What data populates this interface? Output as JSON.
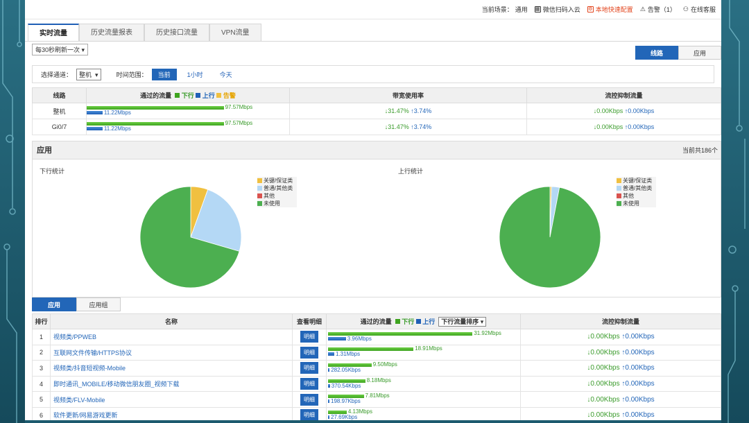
{
  "topbar": {
    "scene_label": "当前场景：",
    "scene_value": "通用",
    "wechat": "微信扫码入云",
    "quick_config": "本地快速配置",
    "alarm": "告警（1）",
    "support": "在线客服"
  },
  "tabs": [
    "实时流量",
    "历史流量报表",
    "历史接口流量",
    "VPN流量"
  ],
  "refresh_select": "每30秒刷新一次",
  "view_toggle": [
    "线路",
    "应用"
  ],
  "filter": {
    "channel_label": "选择通道：",
    "channel_value": "整机",
    "range_label": "时间范围：",
    "ranges": [
      "当前",
      "1小时",
      "今天"
    ]
  },
  "line_table": {
    "headers": {
      "line": "线路",
      "flow": "通过的流量",
      "down": "下行",
      "up": "上行",
      "alarm": "告警",
      "bw": "带宽使用率",
      "ctrl": "流控抑制流量"
    },
    "rows": [
      {
        "name": "整机",
        "down": "97.57Mbps",
        "up": "11.22Mbps",
        "down_pct": 0.95,
        "up_pct": 0.11,
        "bw_down": "↓31.47%",
        "bw_up": "↑3.74%",
        "ctrl_down": "↓0.00Kbps",
        "ctrl_up": "↑0.00Kbps"
      },
      {
        "name": "Gi0/7",
        "down": "97.57Mbps",
        "up": "11.22Mbps",
        "down_pct": 0.95,
        "up_pct": 0.11,
        "bw_down": "↓31.47%",
        "bw_up": "↑3.74%",
        "ctrl_down": "↓0.00Kbps",
        "ctrl_up": "↑0.00Kbps"
      }
    ]
  },
  "app_section": {
    "title": "应用",
    "count": "当前共186个",
    "down_title": "下行统计",
    "up_title": "上行统计",
    "legend": [
      "关键/保证类",
      "普通/其他类",
      "其他",
      "未使用"
    ],
    "colors": [
      "#f0c040",
      "#b4d8f5",
      "#d9534f",
      "#4caf50"
    ]
  },
  "chart_data": [
    {
      "type": "pie",
      "title": "下行统计",
      "categories": [
        "关键/保证类",
        "普通/其他类",
        "其他",
        "未使用"
      ],
      "values": [
        5.5,
        24,
        0,
        70.5
      ]
    },
    {
      "type": "pie",
      "title": "上行统计",
      "categories": [
        "关键/保证类",
        "普通/其他类",
        "其他",
        "未使用"
      ],
      "values": [
        0.5,
        2.5,
        0,
        97
      ]
    }
  ],
  "sub_tabs": [
    "应用",
    "应用组"
  ],
  "app_table": {
    "headers": {
      "rank": "排行",
      "name": "名称",
      "detail": "查看明细",
      "flow": "通过的流量",
      "down": "下行",
      "up": "上行",
      "sort": "下行流量排序",
      "ctrl": "流控抑制流量"
    },
    "detail_label": "明细",
    "rows": [
      {
        "rank": "1",
        "name": "视频类/PPWEB",
        "down": "31.92Mbps",
        "up": "3.96Mbps",
        "down_pct": 0.93,
        "up_pct": 0.115,
        "ctrl_down": "↓0.00Kbps",
        "ctrl_up": "↑0.00Kbps"
      },
      {
        "rank": "2",
        "name": "互联网文件传输/HTTPS协议",
        "down": "18.91Mbps",
        "up": "1.31Mbps",
        "down_pct": 0.55,
        "up_pct": 0.04,
        "ctrl_down": "↓0.00Kbps",
        "ctrl_up": "↑0.00Kbps"
      },
      {
        "rank": "3",
        "name": "视频类/抖音短视频-Mobile",
        "down": "9.50Mbps",
        "up": "282.05Kbps",
        "down_pct": 0.28,
        "up_pct": 0.01,
        "ctrl_down": "↓0.00Kbps",
        "ctrl_up": "↑0.00Kbps"
      },
      {
        "rank": "4",
        "name": "即时通讯_MOBILE/移动微信朋友圈_视频下载",
        "down": "8.18Mbps",
        "up": "370.54Kbps",
        "down_pct": 0.24,
        "up_pct": 0.012,
        "ctrl_down": "↓0.00Kbps",
        "ctrl_up": "↑0.00Kbps"
      },
      {
        "rank": "5",
        "name": "视频类/FLV-Mobile",
        "down": "7.81Mbps",
        "up": "198.97Kbps",
        "down_pct": 0.23,
        "up_pct": 0.007,
        "ctrl_down": "↓0.00Kbps",
        "ctrl_up": "↑0.00Kbps"
      },
      {
        "rank": "6",
        "name": "软件更新/网易游戏更新",
        "down": "4.13Mbps",
        "up": "27.69Kbps",
        "down_pct": 0.12,
        "up_pct": 0.003,
        "ctrl_down": "↓0.00Kbps",
        "ctrl_up": "↑0.00Kbps"
      }
    ]
  }
}
